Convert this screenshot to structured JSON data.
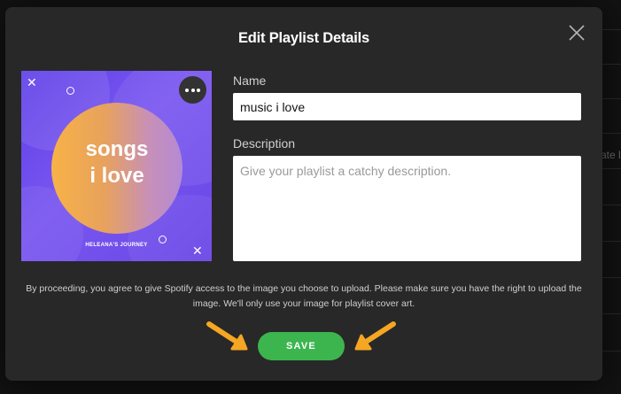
{
  "dialog": {
    "title": "Edit Playlist Details",
    "close_icon": "close-icon"
  },
  "cover": {
    "main_text_line1": "songs",
    "main_text_line2": "i love",
    "sub_text": "HELEANA'S JOURNEY",
    "more_icon": "more-options-icon"
  },
  "form": {
    "name_label": "Name",
    "name_value": "music i love",
    "description_label": "Description",
    "description_placeholder": "Give your playlist a catchy description."
  },
  "disclaimer": "By proceeding, you agree to give Spotify access to the image you choose to upload. Please make sure you have the right to upload the image. We'll only use your image for playlist cover art.",
  "save_label": "SAVE",
  "background": {
    "partial_text": "ate l"
  },
  "colors": {
    "modal_bg": "#282828",
    "save_green": "#3cb54e",
    "arrow_orange": "#f5a623"
  }
}
